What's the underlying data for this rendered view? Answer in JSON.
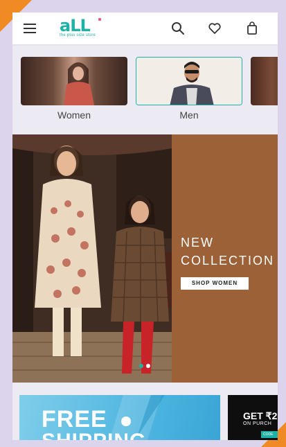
{
  "header": {
    "logo": {
      "text": "aLL",
      "tagline": "the plus size store"
    },
    "icons": [
      "menu-icon",
      "search-icon",
      "heart-icon",
      "bag-icon"
    ]
  },
  "categories": [
    {
      "label": "Women"
    },
    {
      "label": "Men"
    },
    {
      "label": ""
    }
  ],
  "banner": {
    "new_label": "NEW",
    "collection_label": "COLLECTION",
    "cta_label": "SHOP WOMEN"
  },
  "promos": {
    "free_title": "FREE",
    "shipping_title": "SHIPPING",
    "get_text": "GET ₹2",
    "purchase_text": "ON PURCH",
    "code_text": "CODE"
  },
  "colors": {
    "brand": "#1eb2a6",
    "frame": "#dcd3ec",
    "corner_accent": "#f08a24",
    "banner_side": "#9c6136"
  }
}
